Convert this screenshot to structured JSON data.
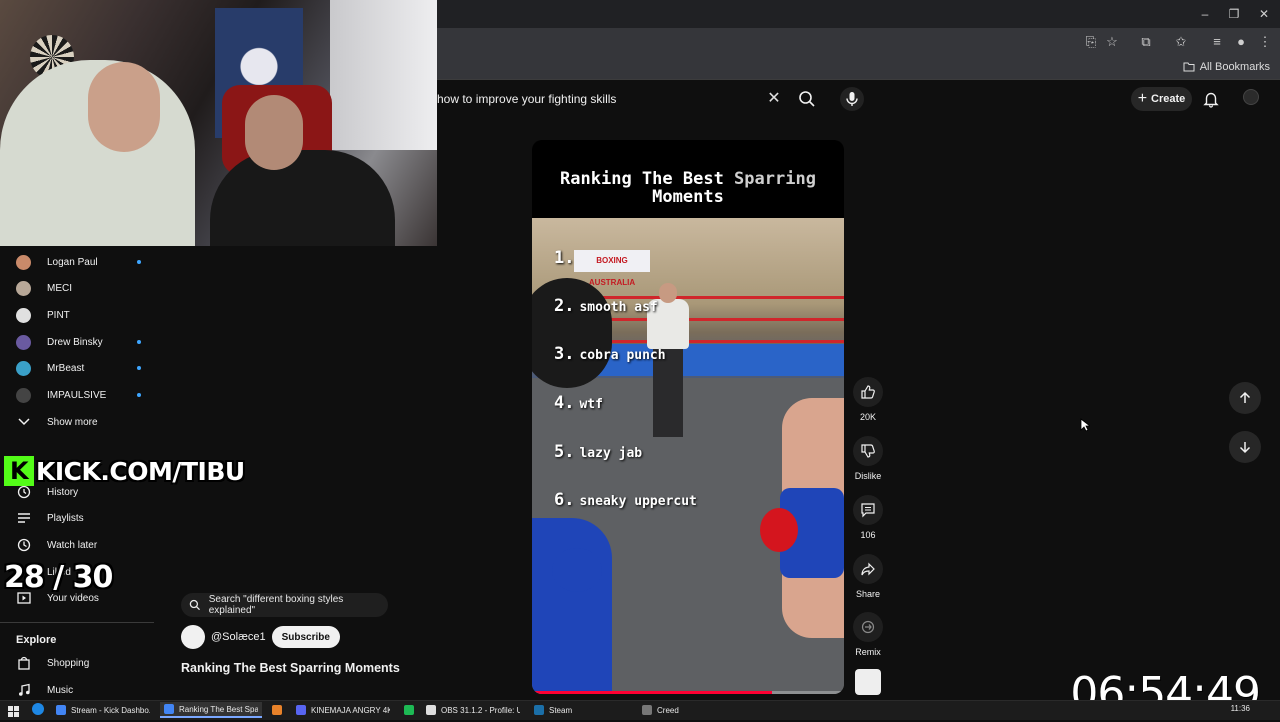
{
  "browser": {
    "all_bookmarks": "All Bookmarks"
  },
  "search": {
    "query": "how to improve your fighting skills"
  },
  "header": {
    "create_label": "Create"
  },
  "sidebar": {
    "subscriptions": [
      {
        "name": "Logan Paul",
        "new": true,
        "color": "#c98a6a"
      },
      {
        "name": "MECI",
        "new": false,
        "color": "#b8a898"
      },
      {
        "name": "PINT",
        "new": false,
        "color": "#e0e0e0"
      },
      {
        "name": "Drew Binsky",
        "new": true,
        "color": "#6a5aa0"
      },
      {
        "name": "MrBeast",
        "new": true,
        "color": "#3aa0c8"
      },
      {
        "name": "IMPAULSIVE",
        "new": true,
        "color": "#444444"
      }
    ],
    "show_more": "Show more",
    "you_items": {
      "history": "History",
      "playlists": "Playlists",
      "watch_later": "Watch later",
      "liked": "Liked",
      "your_videos": "Your videos"
    },
    "explore_title": "Explore",
    "explore_items": {
      "shopping": "Shopping",
      "music": "Music"
    }
  },
  "overlay": {
    "kick_text": "KICK.COM/TIBU",
    "kick_logo": "K",
    "counter": "28 / 30",
    "timer": "06:54:49"
  },
  "short": {
    "suggestion": "Search \"different boxing styles explained\"",
    "channel": "@Solæce1",
    "subscribe": "Subscribe",
    "title": "Ranking The Best Sparring Moments",
    "video_title_main": "Ranking The Best ",
    "video_title_accent": "Sparring",
    "video_title_line2": "Moments",
    "ranks": [
      {
        "num": "1.",
        "label": ""
      },
      {
        "num": "2.",
        "label": "smooth asf"
      },
      {
        "num": "3.",
        "label": "cobra punch"
      },
      {
        "num": "4.",
        "label": "wtf"
      },
      {
        "num": "5.",
        "label": "lazy jab"
      },
      {
        "num": "6.",
        "label": "sneaky uppercut"
      }
    ],
    "sign_text": "BOXING AUSTRALIA",
    "progress": 0.77,
    "progress_color": "#ff0033"
  },
  "actions": {
    "likes": "20K",
    "dislike": "Dislike",
    "comments": "106",
    "share": "Share",
    "remix": "Remix"
  },
  "taskbar": {
    "items": [
      {
        "label": "Stream - Kick Dashbo...",
        "color": "#4285f4"
      },
      {
        "label": "Ranking The Best Spa...",
        "color": "#4285f4"
      },
      {
        "label": "",
        "color": "#e8822a"
      },
      {
        "label": "KINEMAJA ANGRY 4K...",
        "color": "#5865f2"
      },
      {
        "label": "",
        "color": "#1db954"
      },
      {
        "label": "OBS 31.1.2 - Profile: U...",
        "color": "#dddddd"
      },
      {
        "label": "Steam",
        "color": "#1b6fa8"
      },
      {
        "label": "Creed",
        "color": "#777777"
      }
    ],
    "clock": "11:36"
  }
}
